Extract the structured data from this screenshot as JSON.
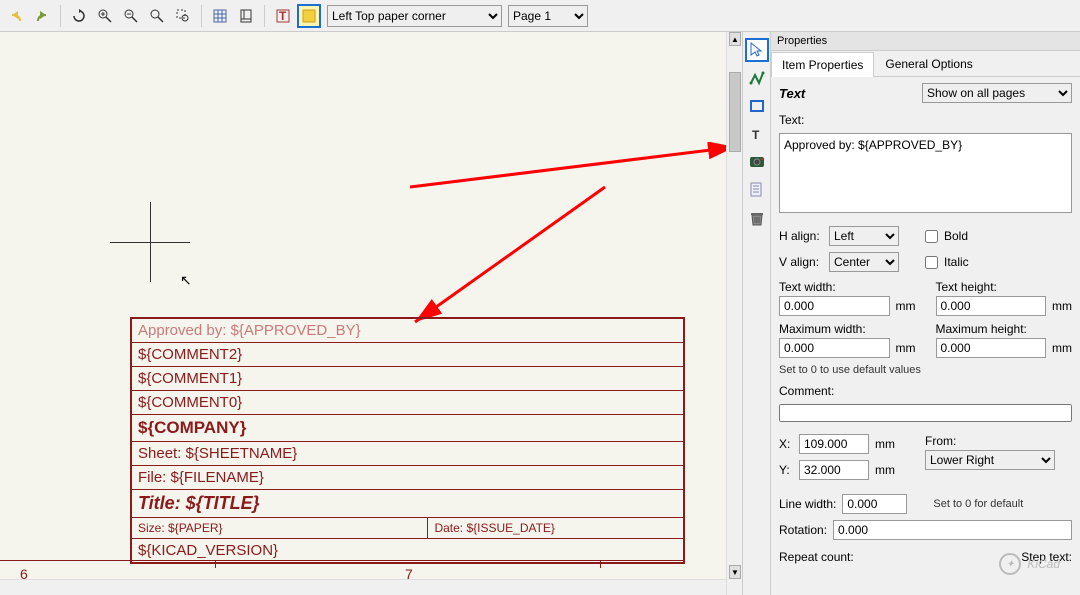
{
  "toolbar": {
    "origin_select": "Left Top paper corner",
    "page_select": "Page 1"
  },
  "canvas": {
    "ruler": {
      "t6": "6",
      "t7": "7"
    },
    "titleblock": {
      "approved": "Approved by: ${APPROVED_BY}",
      "comment2": "${COMMENT2}",
      "comment1": "${COMMENT1}",
      "comment0": "${COMMENT0}",
      "company": "${COMPANY}",
      "sheet": "Sheet: ${SHEETNAME}",
      "file": "File: ${FILENAME}",
      "title": "Title: ${TITLE}",
      "size": "Size: ${PAPER}",
      "date": "Date: ${ISSUE_DATE}",
      "version": "${KICAD_VERSION}"
    }
  },
  "props": {
    "panel_title": "Properties",
    "tab_item": "Item Properties",
    "tab_general": "General Options",
    "section_text": "Text",
    "show_select": "Show on all pages",
    "text_label": "Text:",
    "text_value": "Approved by: ${APPROVED_BY}",
    "halign_label": "H align:",
    "halign_value": "Left",
    "valign_label": "V align:",
    "valign_value": "Center",
    "bold_label": "Bold",
    "italic_label": "Italic",
    "textwidth_label": "Text width:",
    "textwidth_value": "0.000",
    "textheight_label": "Text height:",
    "textheight_value": "0.000",
    "maxwidth_label": "Maximum width:",
    "maxwidth_value": "0.000",
    "maxheight_label": "Maximum height:",
    "maxheight_value": "0.000",
    "unit": "mm",
    "defnote": "Set to 0 to use default values",
    "comment_label": "Comment:",
    "comment_value": "",
    "x_label": "X:",
    "x_value": "109.000",
    "y_label": "Y:",
    "y_value": "32.000",
    "from_label": "From:",
    "from_value": "Lower Right",
    "linewidth_label": "Line width:",
    "linewidth_value": "0.000",
    "linewidth_note": "Set to 0 for default",
    "rotation_label": "Rotation:",
    "rotation_value": "0.000",
    "repeat_label": "Repeat count:",
    "step_label": "Step text:"
  },
  "watermark": "KiCad"
}
